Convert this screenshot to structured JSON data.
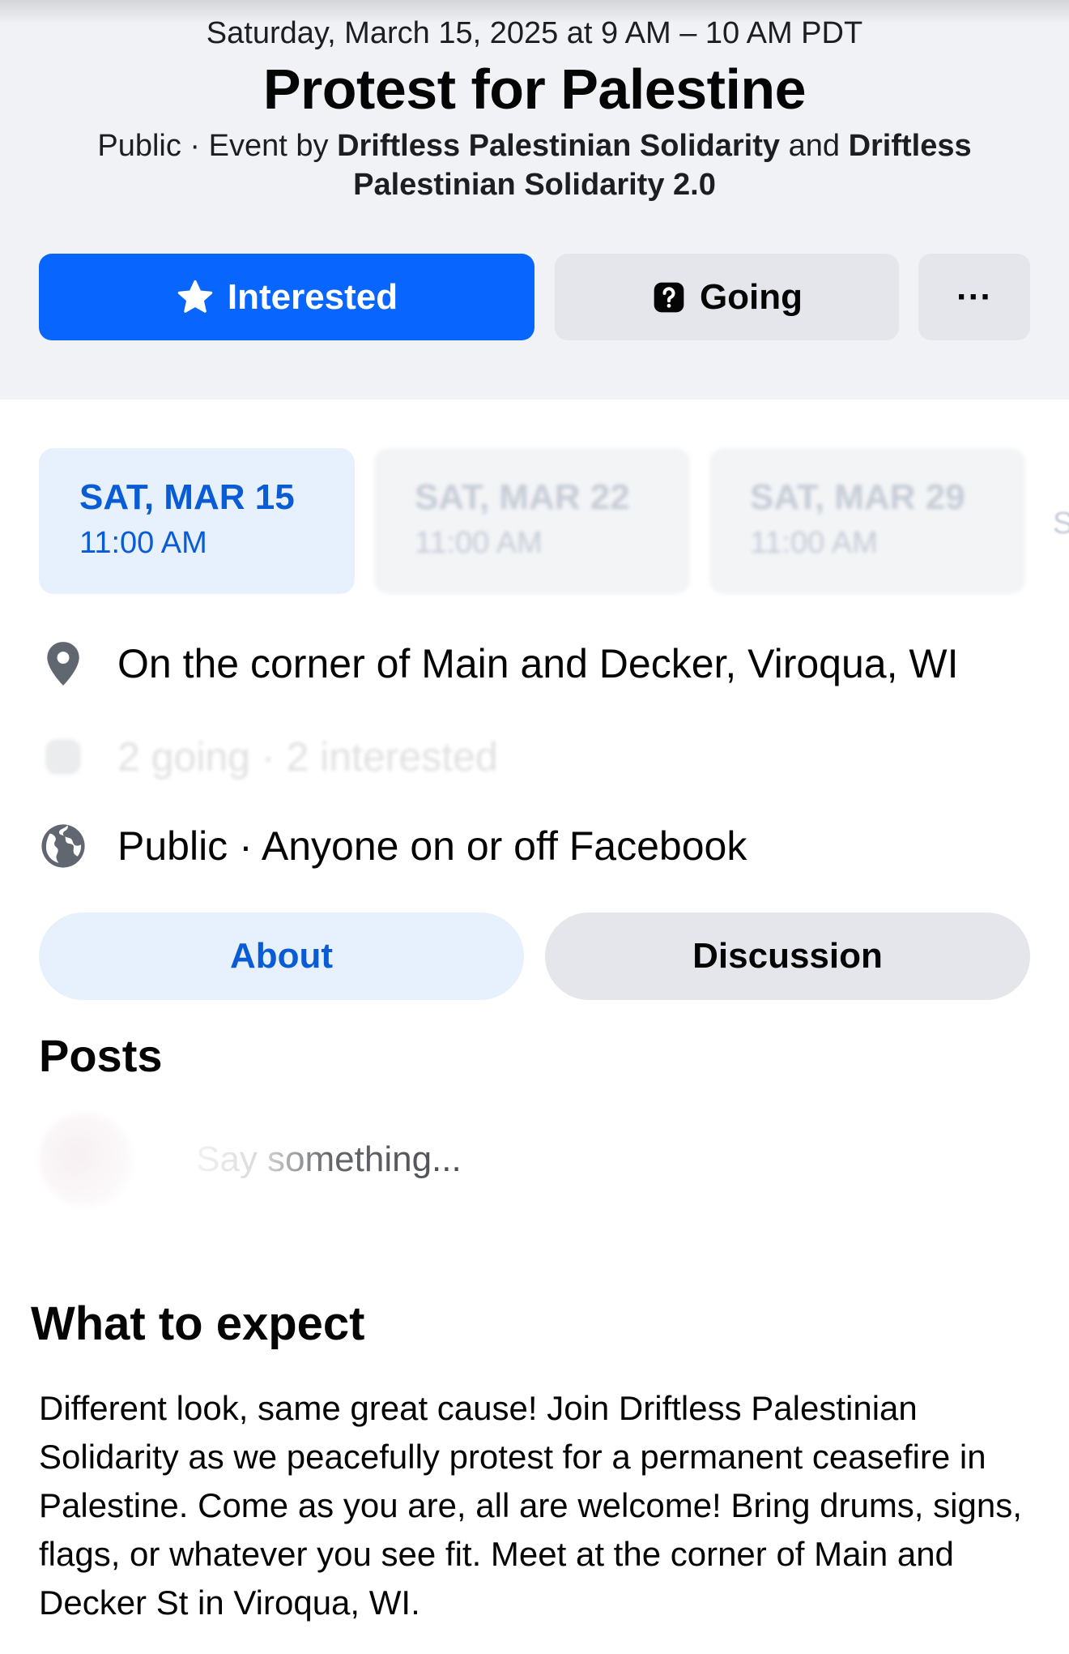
{
  "event": {
    "datetime": "Saturday, March 15, 2025 at 9 AM – 10 AM PDT",
    "title": "Protest for Palestine",
    "privacy_prefix": "Public · Event by ",
    "host_1": "Driftless Palestinian Solidarity",
    "and_word": " and ",
    "host_2": "Driftless Palestinian Solidarity 2.0"
  },
  "actions": {
    "interested_label": "Interested",
    "going_label": "Going",
    "more_label": "···"
  },
  "dates": [
    {
      "day": "SAT, MAR 15",
      "time": "11:00 AM"
    },
    {
      "day": "SAT, MAR 22",
      "time": "11:00 AM"
    },
    {
      "day": "SAT, MAR 29",
      "time": "11:00 AM"
    }
  ],
  "dates_peek": "S",
  "details": {
    "location": "On the corner of Main and Decker, Viroqua, WI",
    "attendance": "2 going · 2 interested",
    "visibility": "Public · Anyone on or off Facebook"
  },
  "tabs": {
    "about": "About",
    "discussion": "Discussion"
  },
  "posts": {
    "heading": "Posts",
    "placeholder": "Say something..."
  },
  "about": {
    "heading": "What to expect",
    "description": "Different look, same great cause! Join Driftless Palestinian Solidarity as we peacefully protest for a permanent ceasefire in Palestine. Come as you are, all are welcome! Bring drums, signs, flags, or whatever you see fit. Meet at the corner of Main and Decker St in Viroqua, WI."
  },
  "colors": {
    "primary_blue": "#0866ff",
    "selected_blue_text": "#0a5bd6",
    "selected_bg": "#e7f1fd",
    "secondary_button": "#e4e6eb",
    "header_bg": "#f0f2f5"
  },
  "icons": {
    "interested": "star-icon",
    "going": "question-box-icon",
    "more": "more-dots-icon",
    "location": "map-pin-icon",
    "attendance": "people-icon",
    "visibility": "globe-icon"
  }
}
